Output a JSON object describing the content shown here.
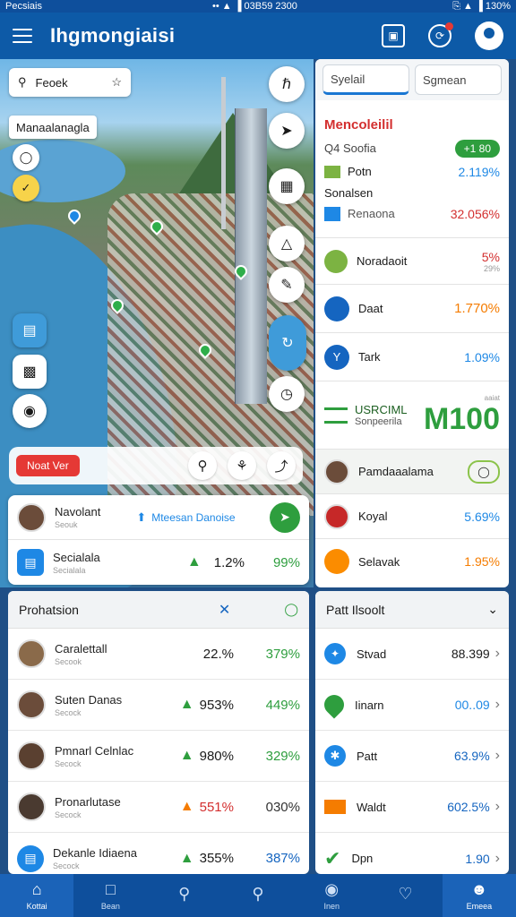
{
  "statusbar": {
    "left": "Pecsiais",
    "center": "•• ▲ ▐ 03B59 2300",
    "right": "⎘ ▲ ▐ 130%"
  },
  "appbar": {
    "title": "Ihgmongiaisi"
  },
  "map": {
    "search_text": "Feoek",
    "map_label": "Manaalanagla",
    "action_chip": "Noat Ver"
  },
  "summary": {
    "row1": {
      "name": "Navolant",
      "sub": "Seouk",
      "link": "Mteesan Danoise"
    },
    "row2": {
      "name": "Secialala",
      "sub": "Secialala",
      "pct": "1.2%",
      "pct2": "99%"
    }
  },
  "right_panel": {
    "tabs": [
      "Syelail",
      "Sgmean"
    ],
    "header": {
      "title": "Mencoleilil",
      "badge": "+1 80",
      "sub": "Q4 Soofia"
    },
    "kv": [
      {
        "label": "Potn",
        "value": "2.119%"
      },
      {
        "label": "Sonalsen",
        "value": ""
      },
      {
        "label": "Renaona",
        "value": "32.056%"
      }
    ],
    "items": [
      {
        "name": "Noradaoit",
        "pct": "5%",
        "pct2": "29%"
      },
      {
        "name": "Daat",
        "pct": "1.770%"
      },
      {
        "name": "Tark",
        "pct": "1.09%"
      }
    ],
    "usage": {
      "title": "USRCIML",
      "sub": "Sonpeerila",
      "big": "M100",
      "tag": "aaiat"
    },
    "people": [
      {
        "name": "Pamdaaalama"
      },
      {
        "name": "Koyal",
        "pct": "5.69%"
      },
      {
        "name": "Selavak",
        "pct": "1.95%"
      }
    ]
  },
  "left_list": {
    "title": "Prohatsion",
    "rows": [
      {
        "name": "Caralettall",
        "sub": "Secook",
        "pct": "22.%",
        "pct2": "379%"
      },
      {
        "name": "Suten Danas",
        "sub": "Secock",
        "pct": "953%",
        "pct2": "449%"
      },
      {
        "name": "Pmnarl Celnlac",
        "sub": "Secock",
        "pct": "980%",
        "pct2": "329%"
      },
      {
        "name": "Pronarlutase",
        "sub": "Secock",
        "pct": "551%",
        "pct2": "030%"
      },
      {
        "name": "Dekanle Idiaena",
        "sub": "Secock",
        "pct": "355%",
        "pct2": "387%"
      }
    ]
  },
  "right_list": {
    "title": "Patt Ilsoolt",
    "rows": [
      {
        "name": "Stvad",
        "value": "88.399"
      },
      {
        "name": "Iinarn",
        "value": "00..09"
      },
      {
        "name": "Patt",
        "value": "63.9%"
      },
      {
        "name": "Waldt",
        "value": "602.5%"
      },
      {
        "name": "Dpn",
        "value": "1.90"
      }
    ]
  },
  "bottom_nav": [
    "Kottai",
    "Bean",
    "",
    "",
    "Inen",
    "",
    "Emeea"
  ],
  "colors": {
    "primary": "#0d5aa7",
    "green": "#2e9e3e",
    "red": "#d32f2f",
    "blue": "#1e88e5",
    "orange": "#f57c00"
  }
}
